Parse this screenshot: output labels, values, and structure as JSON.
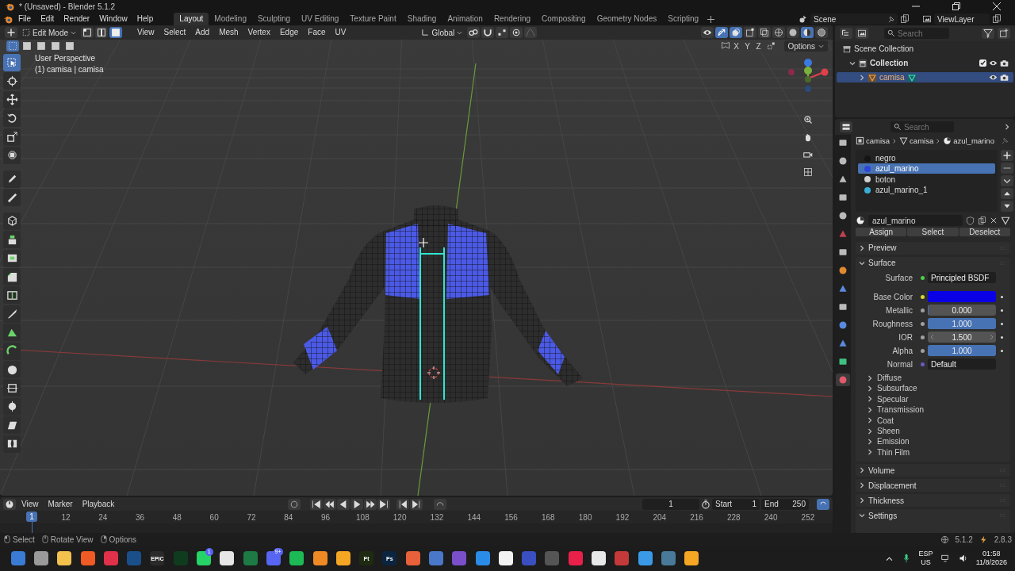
{
  "window": {
    "title": "* (Unsaved) - Blender 5.1.2"
  },
  "menu": [
    "File",
    "Edit",
    "Render",
    "Window",
    "Help"
  ],
  "workspaces": [
    {
      "label": "Layout",
      "selected": true
    },
    {
      "label": "Modeling",
      "selected": false
    },
    {
      "label": "Sculpting",
      "selected": false
    },
    {
      "label": "UV Editing",
      "selected": false
    },
    {
      "label": "Texture Paint",
      "selected": false
    },
    {
      "label": "Shading",
      "selected": false
    },
    {
      "label": "Animation",
      "selected": false
    },
    {
      "label": "Rendering",
      "selected": false
    },
    {
      "label": "Compositing",
      "selected": false
    },
    {
      "label": "Geometry Nodes",
      "selected": false
    },
    {
      "label": "Scripting",
      "selected": false
    }
  ],
  "scene": {
    "scene": "Scene",
    "view_layer": "ViewLayer"
  },
  "viewport": {
    "mode": "Edit Mode",
    "select_modes": [
      {
        "selected": false
      },
      {
        "selected": false
      },
      {
        "selected": true
      }
    ],
    "menus": [
      "View",
      "Select",
      "Add",
      "Mesh",
      "Vertex",
      "Edge",
      "Face",
      "UV"
    ],
    "orientation": "Global",
    "axes": [
      "X",
      "Y",
      "Z"
    ],
    "options": "Options",
    "info": [
      "User Perspective",
      "(1) camisa | camisa"
    ],
    "tools": [
      {
        "kind": "select",
        "selected": true
      },
      {
        "kind": "cursor",
        "selected": false
      },
      {
        "kind": "move",
        "selected": false
      },
      {
        "kind": "rotate",
        "selected": false
      },
      {
        "kind": "scale",
        "selected": false
      },
      {
        "kind": "transform",
        "selected": false
      },
      {
        "kind": "annotate",
        "selected": false
      },
      {
        "kind": "measure",
        "selected": false
      },
      {
        "kind": "add",
        "selected": false
      },
      {
        "kind": "extrude",
        "selected": false
      },
      {
        "kind": "inset",
        "selected": false
      },
      {
        "kind": "bevel",
        "selected": false
      },
      {
        "kind": "loopcut",
        "selected": false
      },
      {
        "kind": "knife",
        "selected": false
      },
      {
        "kind": "polybuild",
        "selected": false
      },
      {
        "kind": "spin",
        "selected": false
      },
      {
        "kind": "smooth",
        "selected": false
      },
      {
        "kind": "slide",
        "selected": false
      },
      {
        "kind": "shrink",
        "selected": false
      },
      {
        "kind": "shear",
        "selected": false
      },
      {
        "kind": "rip",
        "selected": false
      }
    ]
  },
  "outliner": {
    "search": {
      "placeholder": "Search"
    },
    "tree": [
      {
        "label": "Scene Collection",
        "kind": "scene",
        "selected": false,
        "children": [
          {
            "label": "Collection",
            "kind": "collection",
            "selected": false,
            "expanded": true,
            "checked": true,
            "children": [
              {
                "label": "camisa",
                "kind": "mesh",
                "selected": true,
                "expanded": false
              }
            ]
          }
        ]
      }
    ]
  },
  "properties": {
    "search": {
      "placeholder": "Search"
    },
    "tabs": [
      {
        "selected": false
      },
      {
        "selected": false
      },
      {
        "selected": false
      },
      {
        "selected": false
      },
      {
        "selected": false
      },
      {
        "selected": false
      },
      {
        "selected": false
      },
      {
        "selected": false
      },
      {
        "selected": false
      },
      {
        "selected": false
      },
      {
        "selected": false
      },
      {
        "selected": false
      },
      {
        "selected": false
      },
      {
        "selected": true
      }
    ],
    "breadcrumb": [
      "camisa",
      "camisa",
      "azul_marino"
    ],
    "slots": [
      {
        "name": "negro",
        "color": "#151515",
        "selected": false
      },
      {
        "name": "azul_marino",
        "color": "#2f44d8",
        "selected": true
      },
      {
        "name": "boton",
        "color": "#d0d0d0",
        "selected": false
      },
      {
        "name": "azul_marino_1",
        "color": "#3aaed6",
        "selected": false
      }
    ],
    "material": "azul_marino",
    "slot_buttons": [
      "Assign",
      "Select",
      "Deselect"
    ],
    "panels": [
      {
        "label": "Preview",
        "expanded": false
      },
      {
        "label": "Surface",
        "expanded": true,
        "surface": {
          "label": "Surface",
          "value": "Principled BSDF"
        },
        "inputs": [
          {
            "kind": "color",
            "label": "Base Color",
            "color": "#0a00e6"
          },
          {
            "kind": "slider",
            "label": "Metallic",
            "value": "0.000",
            "level": 0
          },
          {
            "kind": "slider",
            "label": "Roughness",
            "value": "1.000",
            "level": 1
          },
          {
            "kind": "stepper",
            "label": "IOR",
            "value": "1.500"
          },
          {
            "kind": "slider",
            "label": "Alpha",
            "value": "1.000",
            "level": 1
          },
          {
            "kind": "link",
            "label": "Normal",
            "value": "Default"
          }
        ],
        "subpanels": [
          {
            "label": "Diffuse",
            "expanded": false
          },
          {
            "label": "Subsurface",
            "expanded": false
          },
          {
            "label": "Specular",
            "expanded": false
          },
          {
            "label": "Transmission",
            "expanded": false
          },
          {
            "label": "Coat",
            "expanded": false
          },
          {
            "label": "Sheen",
            "expanded": false
          },
          {
            "label": "Emission",
            "expanded": false
          },
          {
            "label": "Thin Film",
            "expanded": false
          }
        ]
      },
      {
        "label": "Volume",
        "expanded": false
      },
      {
        "label": "Displacement",
        "expanded": false
      },
      {
        "label": "Thickness",
        "expanded": false
      },
      {
        "label": "Settings",
        "expanded": true
      }
    ]
  },
  "timeline": {
    "menus": [
      "View",
      "Marker",
      "Playback"
    ],
    "frame": "1",
    "start_label": "Start",
    "start": "1",
    "end_label": "End",
    "end": "250",
    "current": "1",
    "ticks": [
      "12",
      "24",
      "36",
      "48",
      "60",
      "72",
      "84",
      "96",
      "108",
      "120",
      "132",
      "144",
      "156",
      "168",
      "180",
      "192",
      "204",
      "216",
      "228",
      "240",
      "252"
    ]
  },
  "status_bar": {
    "hints": [
      "Select",
      "Rotate View",
      "Options"
    ],
    "version": "5.1.2",
    "extra": "2.8.3"
  },
  "taskbar": {
    "apps": [
      {
        "color": "#3a7bd5"
      },
      {
        "color": "#9a9a9a"
      },
      {
        "color": "#f2c14e"
      },
      {
        "color": "#f05a24"
      },
      {
        "color": "#e0304a"
      },
      {
        "color": "#1b4f8a"
      },
      {
        "color": "#2a2a2a",
        "label": "EPIC"
      },
      {
        "color": "#0f3b1f"
      },
      {
        "color": "#25d366",
        "badge": "1"
      },
      {
        "color": "#e6e6e6"
      },
      {
        "color": "#1d7a44"
      },
      {
        "color": "#5865f2",
        "badge": "9+"
      },
      {
        "color": "#1db954"
      },
      {
        "color": "#f08a24"
      },
      {
        "color": "#f5a623"
      },
      {
        "color": "#1f2a12",
        "label": "Pt"
      },
      {
        "color": "#0b2440",
        "label": "Ps"
      },
      {
        "color": "#e8613a"
      },
      {
        "color": "#4a78c8"
      },
      {
        "color": "#7a4fc9"
      },
      {
        "color": "#2a8ce8"
      },
      {
        "color": "#f2f2f2"
      },
      {
        "color": "#3a4fc0"
      },
      {
        "color": "#555555"
      },
      {
        "color": "#e8204a"
      },
      {
        "color": "#e8e8e8"
      },
      {
        "color": "#c43a3a"
      },
      {
        "color": "#3a9ae8"
      },
      {
        "color": "#4a7a9a"
      },
      {
        "color": "#f5a623"
      }
    ],
    "language": "ESP",
    "layout": "US",
    "time": "01:58",
    "date": "11/8/2026"
  }
}
